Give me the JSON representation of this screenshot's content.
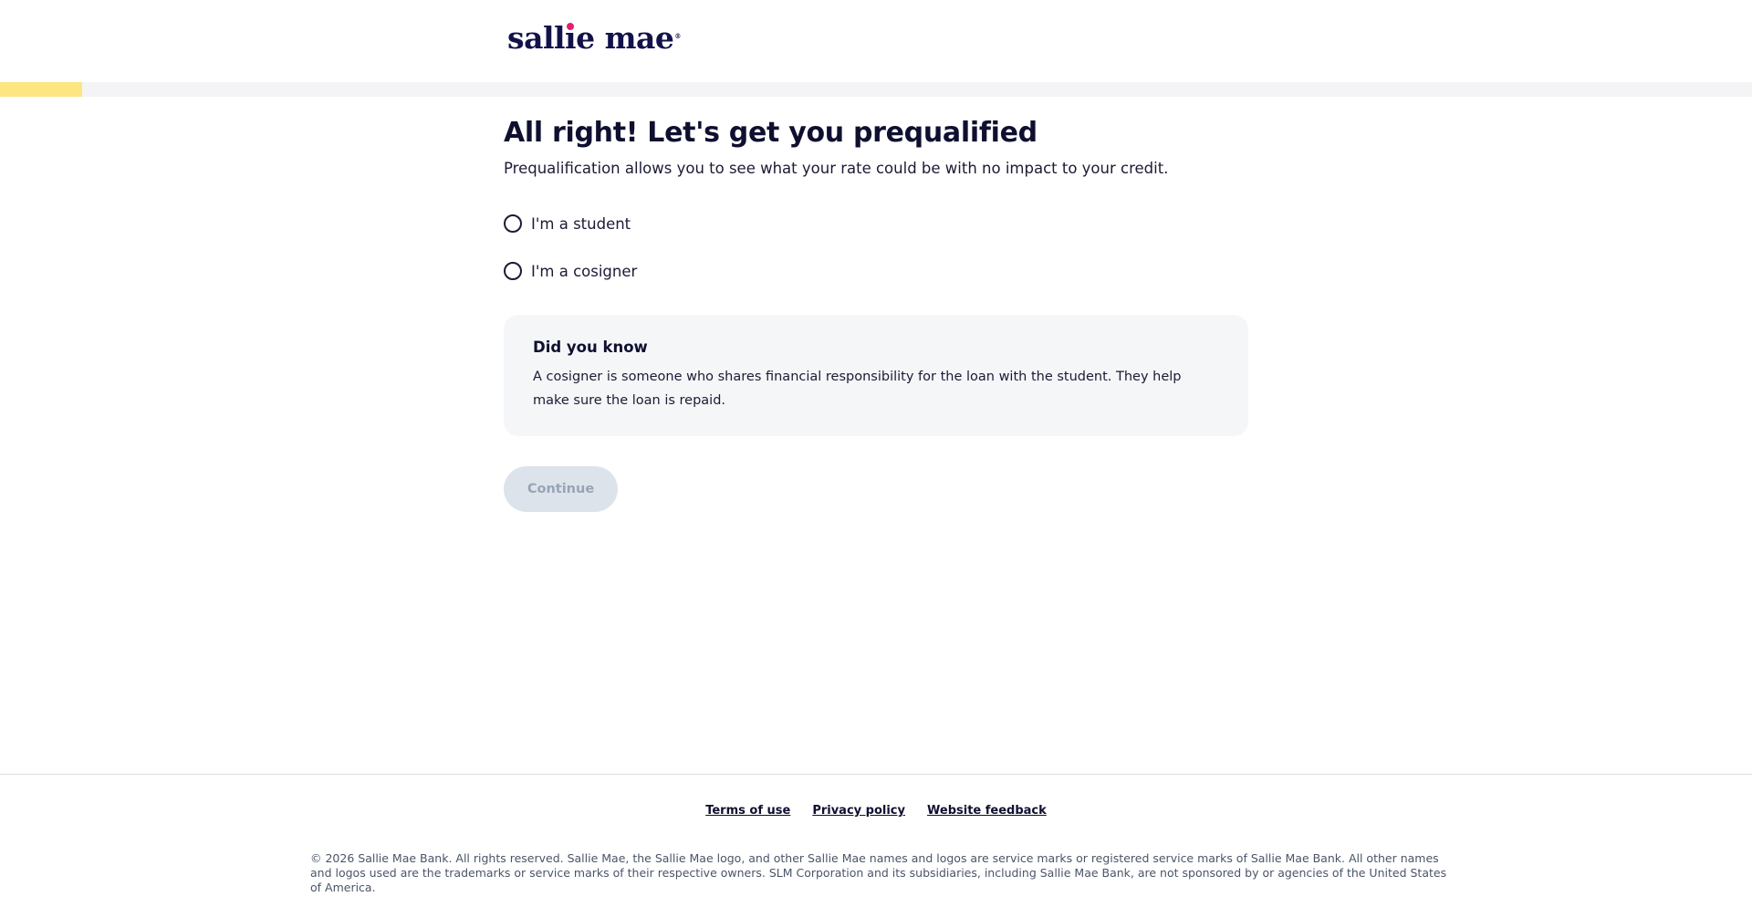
{
  "header": {
    "logo_text_before": "sall",
    "logo_text_i": "ı",
    "logo_text_after": "e mae",
    "logo_tm": "®"
  },
  "progress": {
    "value_percent": 4.7,
    "fill_color": "#fde581"
  },
  "main": {
    "title": "All right! Let's get you prequalified",
    "subtitle": "Prequalification allows you to see what your rate could be with no impact to your credit.",
    "options": [
      {
        "label": "I'm a student",
        "selected": false
      },
      {
        "label": "I'm a cosigner",
        "selected": false
      }
    ],
    "info": {
      "title": "Did you know",
      "text": "A cosigner is someone who shares financial responsibility for the loan with the student. They help make sure the loan is repaid."
    },
    "continue_label": "Continue"
  },
  "footer": {
    "links": [
      "Terms of use",
      "Privacy policy",
      "Website feedback"
    ],
    "legal": "© 2026 Sallie Mae Bank. All rights reserved. Sallie Mae, the Sallie Mae logo, and other Sallie Mae names and logos are service marks or registered service marks of Sallie Mae Bank. All other names and logos used are the trademarks or service marks of their respective owners. SLM Corporation and its subsidiaries, including Sallie Mae Bank, are not sponsored by or agencies of the United States of America."
  },
  "colors": {
    "brand_navy": "#12124a",
    "brand_pink": "#e11f6e",
    "progress_yellow": "#fde581",
    "card_bg": "#f5f6f8",
    "button_disabled_bg": "#dde3ea"
  }
}
